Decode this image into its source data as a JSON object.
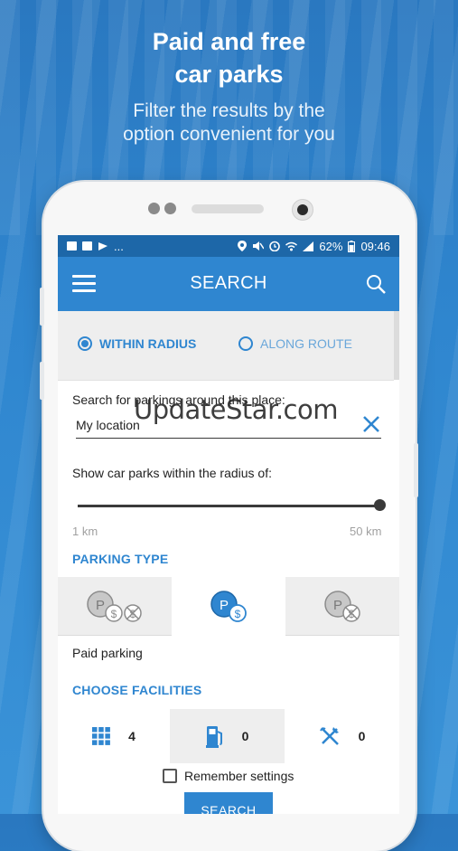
{
  "promo": {
    "headline_line1": "Paid and free",
    "headline_line2": "car parks",
    "subline_line1": "Filter the results by the",
    "subline_line2": "option convenient for you"
  },
  "status_bar": {
    "left_icons": [
      "image-icon",
      "mail-icon",
      "flag-icon"
    ],
    "ellipsis": "...",
    "right_icons": [
      "location-icon",
      "mute-icon",
      "alarm-icon",
      "wifi-icon",
      "signal-icon"
    ],
    "battery": "62%",
    "time": "09:46"
  },
  "app_bar": {
    "title": "SEARCH",
    "menu_icon": "hamburger-icon",
    "search_icon": "search-icon"
  },
  "search_mode": {
    "options": [
      {
        "label": "WITHIN RADIUS",
        "selected": true
      },
      {
        "label": "ALONG ROUTE",
        "selected": false
      }
    ]
  },
  "location": {
    "label": "Search for parkings around this place:",
    "value": "My location"
  },
  "radius": {
    "label": "Show car parks within the radius of:",
    "min_label": "1 km",
    "max_label": "50 km",
    "value_fraction": 1.0
  },
  "parking_type": {
    "title": "PARKING TYPE",
    "options": [
      {
        "name": "paid-and-free",
        "selected": false
      },
      {
        "name": "paid",
        "selected": true
      },
      {
        "name": "free",
        "selected": false
      }
    ],
    "selected_label": "Paid parking"
  },
  "facilities": {
    "title": "CHOOSE FACILITIES",
    "items": [
      {
        "icon": "grid-icon",
        "count": "4"
      },
      {
        "icon": "fuel-pump-icon",
        "count": "0"
      },
      {
        "icon": "restaurant-icon",
        "count": "0"
      }
    ]
  },
  "remember": {
    "label": "Remember settings",
    "checked": false
  },
  "search_button": {
    "label": "SEARCH"
  },
  "watermark": "UpdateStar.com",
  "colors": {
    "accent": "#2f86d0",
    "status_bar": "#1d67a8",
    "background": "#2f86cf"
  }
}
